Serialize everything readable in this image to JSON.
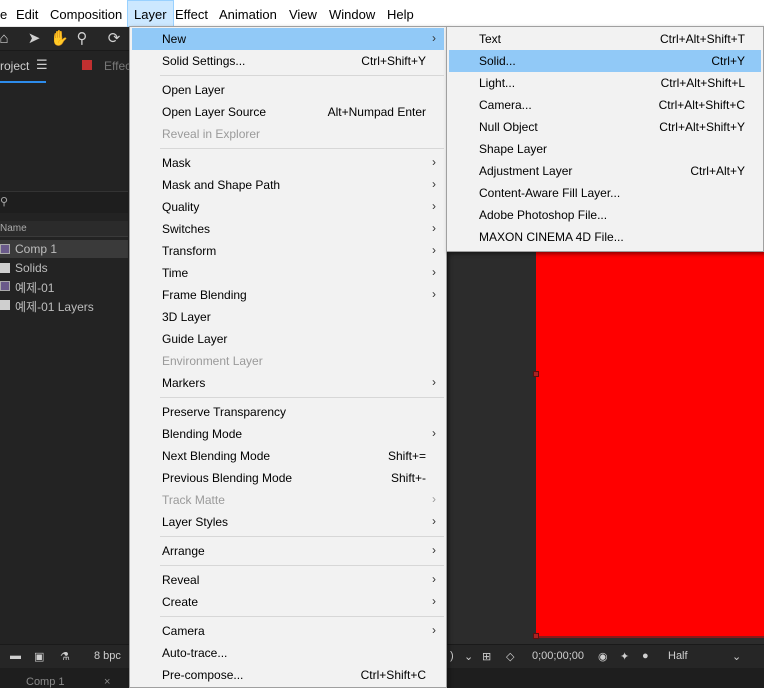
{
  "menubar": [
    "e",
    "Edit",
    "Composition",
    "Layer",
    "Effect",
    "Animation",
    "View",
    "Window",
    "Help"
  ],
  "project": {
    "tab_label": "roject",
    "effects_tab": "Effec",
    "search_glyph": "⚲",
    "column_name": "Name",
    "items": [
      {
        "label": "Comp 1",
        "icon": "composition-icon"
      },
      {
        "label": "Solids",
        "icon": "folder-icon"
      },
      {
        "label": "예제-01",
        "icon": "composition-icon"
      },
      {
        "label": "예제-01 Layers",
        "icon": "folder-icon"
      }
    ]
  },
  "bottom": {
    "bpc": "8 bpc",
    "paren": ")",
    "timecode": "0;00;00;00",
    "resolution": "Half",
    "tab_comp": "Comp 1",
    "tab_close": "×"
  },
  "layer_menu": {
    "items": [
      {
        "label": "New",
        "submenu": true,
        "highlight": true
      },
      {
        "label": "Solid Settings...",
        "shortcut": "Ctrl+Shift+Y"
      },
      {
        "sep": true
      },
      {
        "label": "Open Layer"
      },
      {
        "label": "Open Layer Source",
        "shortcut": "Alt+Numpad Enter"
      },
      {
        "label": "Reveal in Explorer",
        "disabled": true
      },
      {
        "sep": true
      },
      {
        "label": "Mask",
        "submenu": true
      },
      {
        "label": "Mask and Shape Path",
        "submenu": true
      },
      {
        "label": "Quality",
        "submenu": true
      },
      {
        "label": "Switches",
        "submenu": true
      },
      {
        "label": "Transform",
        "submenu": true
      },
      {
        "label": "Time",
        "submenu": true
      },
      {
        "label": "Frame Blending",
        "submenu": true
      },
      {
        "label": "3D Layer"
      },
      {
        "label": "Guide Layer"
      },
      {
        "label": "Environment Layer",
        "disabled": true
      },
      {
        "label": "Markers",
        "submenu": true
      },
      {
        "sep": true
      },
      {
        "label": "Preserve Transparency"
      },
      {
        "label": "Blending Mode",
        "submenu": true
      },
      {
        "label": "Next Blending Mode",
        "shortcut": "Shift+="
      },
      {
        "label": "Previous Blending Mode",
        "shortcut": "Shift+-"
      },
      {
        "label": "Track Matte",
        "submenu": true,
        "disabled": true
      },
      {
        "label": "Layer Styles",
        "submenu": true
      },
      {
        "sep": true
      },
      {
        "label": "Arrange",
        "submenu": true
      },
      {
        "sep": true
      },
      {
        "label": "Reveal",
        "submenu": true
      },
      {
        "label": "Create",
        "submenu": true
      },
      {
        "sep": true
      },
      {
        "label": "Camera",
        "submenu": true
      },
      {
        "label": "Auto-trace..."
      },
      {
        "label": "Pre-compose...",
        "shortcut": "Ctrl+Shift+C"
      }
    ]
  },
  "new_submenu": {
    "items": [
      {
        "label": "Text",
        "shortcut": "Ctrl+Alt+Shift+T"
      },
      {
        "label": "Solid...",
        "shortcut": "Ctrl+Y",
        "highlight": true
      },
      {
        "label": "Light...",
        "shortcut": "Ctrl+Alt+Shift+L"
      },
      {
        "label": "Camera...",
        "shortcut": "Ctrl+Alt+Shift+C"
      },
      {
        "label": "Null Object",
        "shortcut": "Ctrl+Alt+Shift+Y"
      },
      {
        "label": "Shape Layer"
      },
      {
        "label": "Adjustment Layer",
        "shortcut": "Ctrl+Alt+Y"
      },
      {
        "label": "Content-Aware Fill Layer..."
      },
      {
        "label": "Adobe Photoshop File..."
      },
      {
        "label": "MAXON CINEMA 4D File..."
      }
    ]
  },
  "colors": {
    "solid": "#ff0000",
    "menu_highlight": "#91c9f7",
    "menubar_active": "#cce8ff"
  }
}
